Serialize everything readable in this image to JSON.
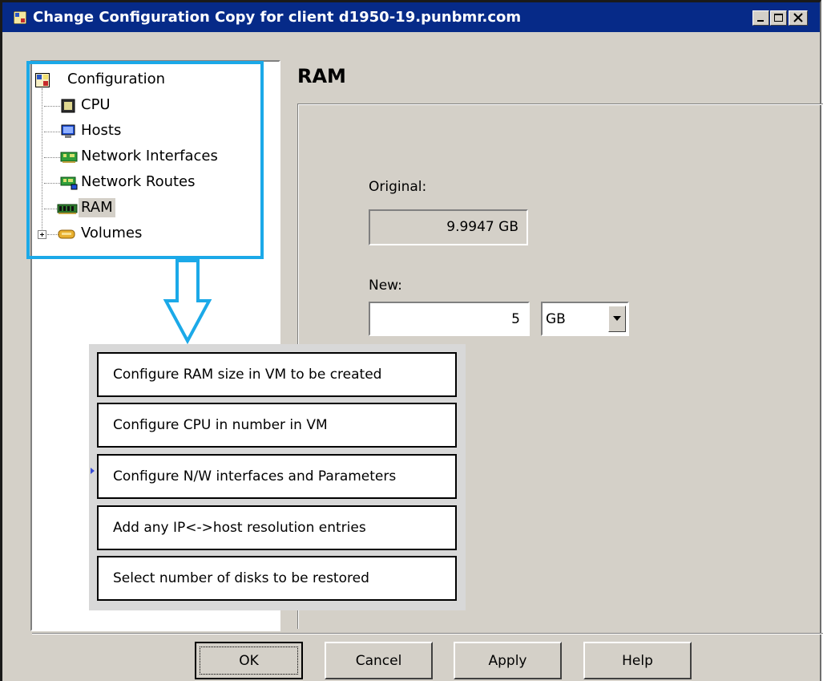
{
  "window": {
    "title": "Change Configuration Copy for client d1950-19.punbmr.com"
  },
  "tree": {
    "root": "Configuration",
    "items": [
      {
        "label": "CPU",
        "icon": "cpu-icon"
      },
      {
        "label": "Hosts",
        "icon": "monitor-icon"
      },
      {
        "label": "Network Interfaces",
        "icon": "network-card-icon"
      },
      {
        "label": "Network Routes",
        "icon": "network-route-icon"
      },
      {
        "label": "RAM",
        "icon": "ram-icon",
        "selected": true
      },
      {
        "label": "Volumes",
        "icon": "volume-icon",
        "expandable": true
      }
    ]
  },
  "panel": {
    "title": "RAM",
    "original_label": "Original:",
    "original_value": "9.9947 GB",
    "new_label": "New:",
    "new_value": "5",
    "unit": "GB"
  },
  "callouts": [
    "Configure RAM size in VM to be created",
    "Configure CPU in number in VM",
    "Configure N/W interfaces and Parameters",
    "Add any IP<->host resolution entries",
    "Select number of disks to be restored"
  ],
  "buttons": {
    "ok": "OK",
    "cancel": "Cancel",
    "apply": "Apply",
    "help": "Help"
  },
  "colors": {
    "titlebar": "#062a88",
    "highlight": "#1ba9e8",
    "face": "#d4d0c8"
  }
}
